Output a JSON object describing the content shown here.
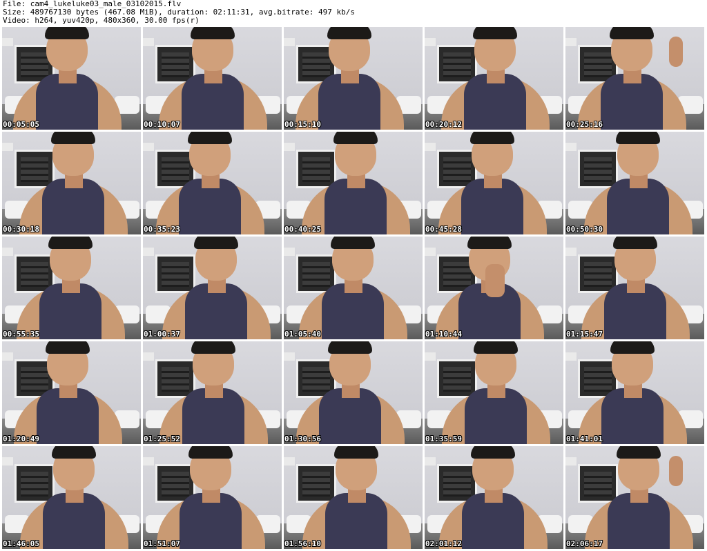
{
  "header": {
    "line1": "File: cam4_lukeluke03_male_03102015.flv",
    "line2": "Size: 489767130 bytes (467.08 MiB), duration: 02:11:31, avg.bitrate: 497 kb/s",
    "line3": "Video: h264, yuv420p, 480x360, 30.00 fps(r)"
  },
  "thumbnails": [
    "00:05:05",
    "00:10:07",
    "00:15:10",
    "00:20:12",
    "00:25:16",
    "00:30:18",
    "00:35:23",
    "00:40:25",
    "00:45:28",
    "00:50:30",
    "00:55:35",
    "01:00:37",
    "01:05:40",
    "01:10:44",
    "01:15:47",
    "01:20:49",
    "01:25:52",
    "01:30:56",
    "01:35:59",
    "01:41:01",
    "01:46:05",
    "01:51:07",
    "01:56:10",
    "02:01:12",
    "02:06:17"
  ],
  "colors": {
    "background": "#ffffff",
    "timestamp_text": "#ffffff",
    "tank_top": "#3b3a55",
    "skin": "#c99a73"
  }
}
